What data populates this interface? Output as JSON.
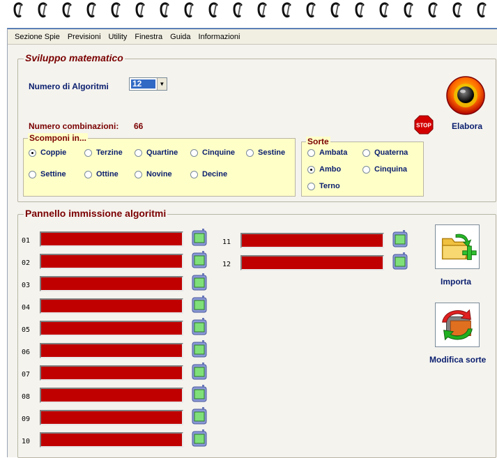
{
  "menu": [
    "Sezione Spie",
    "Previsioni",
    "Utility",
    "Finestra",
    "Guida",
    "Informazioni"
  ],
  "sviluppo": {
    "title": "Sviluppo matematico",
    "num_algoritmi_label": "Numero di Algoritmi",
    "num_algoritmi_value": "12",
    "combinazioni_label": "Numero combinazioni:",
    "combinazioni_value": "66",
    "elabora_label": "Elabora",
    "stop_label": "STOP"
  },
  "scomponi": {
    "title": "Scomponi in...",
    "options": [
      "Coppie",
      "Terzine",
      "Quartine",
      "Cinquine",
      "Sestine",
      "Settine",
      "Ottine",
      "Novine",
      "Decine"
    ],
    "selected": "Coppie"
  },
  "sorte": {
    "title": "Sorte",
    "options": [
      "Ambata",
      "Quaterna",
      "Ambo",
      "Cinquina",
      "Terno"
    ],
    "selected": "Ambo"
  },
  "pannello": {
    "title": "Pannello immissione algoritmi",
    "rows": [
      "01",
      "02",
      "03",
      "04",
      "05",
      "06",
      "07",
      "08",
      "09",
      "10",
      "11",
      "12"
    ],
    "importa_label": "Importa",
    "modifica_label": "Modifica sorte"
  }
}
